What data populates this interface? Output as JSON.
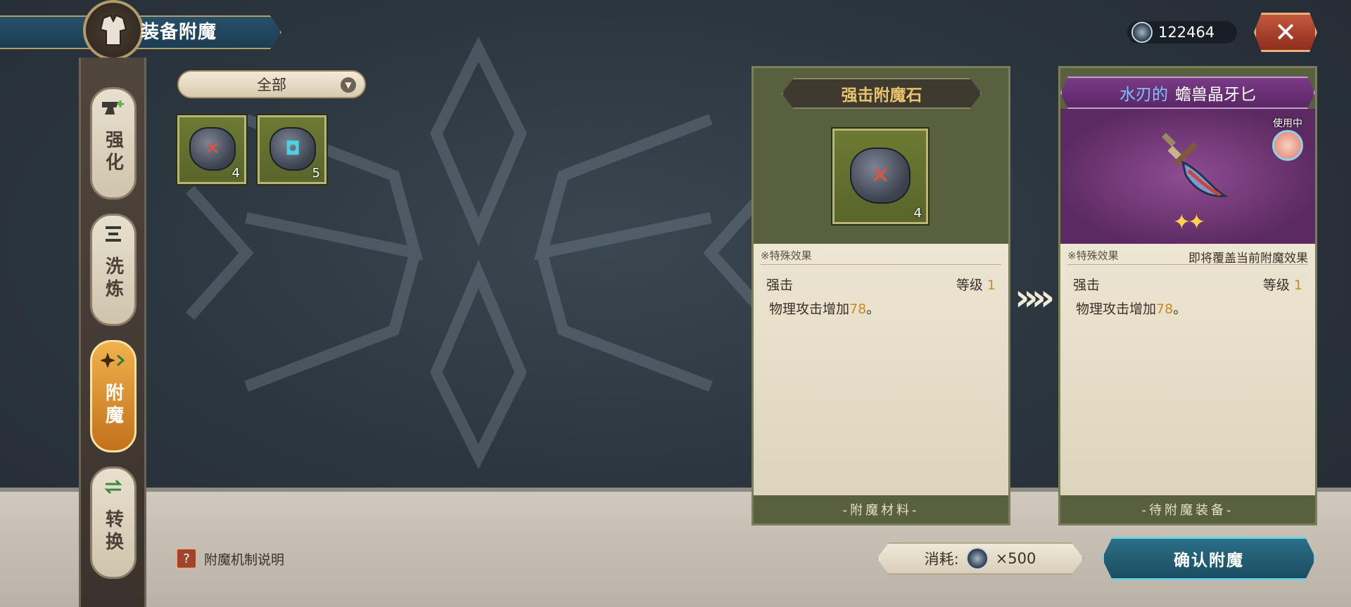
{
  "header": {
    "title": "装备附魔",
    "currency_amount": "122464",
    "close_symbol": "✕"
  },
  "sidebar": {
    "tabs": [
      {
        "label": "强化",
        "icon": "anvil-plus-icon",
        "active": false
      },
      {
        "label": "洗炼",
        "icon": "refine-lines-icon",
        "active": false
      },
      {
        "label": "附魔",
        "icon": "sparkle-arrow-icon",
        "active": true
      },
      {
        "label": "转换",
        "icon": "swap-arrows-icon",
        "active": false
      }
    ]
  },
  "filter": {
    "selected": "全部"
  },
  "inventory": [
    {
      "name": "red rune stone",
      "rune": "✕",
      "rune_color": "#e2503e",
      "count": "4"
    },
    {
      "name": "blue rune stone",
      "rune": "◘",
      "rune_color": "#4ad2e0",
      "count": "5"
    }
  ],
  "material_panel": {
    "name": "强击附魔石",
    "count": "4",
    "section_label": "※特殊效果",
    "effect_name": "强击",
    "level_label": "等级",
    "level_value": "1",
    "desc_prefix": "物理攻击增加",
    "desc_value": "78",
    "desc_suffix": "。",
    "footer": "-附魔材料-"
  },
  "equipment_panel": {
    "name_prefix": "水刃的",
    "name": "蟾兽晶牙匕",
    "in_use_badge": "使用中",
    "stars": "✦✦",
    "section_label": "※特殊效果",
    "overwrite_note": "即将覆盖当前附魔效果",
    "effect_name": "强击",
    "level_label": "等级",
    "level_value": "1",
    "desc_prefix": "物理攻击增加",
    "desc_value": "78",
    "desc_suffix": "。",
    "footer": "-待附魔装备-"
  },
  "transfer_arrows": "»",
  "bottom": {
    "help_label": "附魔机制说明",
    "cost_label": "消耗:",
    "cost_value": "×500",
    "confirm_label": "确认附魔"
  },
  "colors": {
    "accent_gold": "#c78a25",
    "confirm_blue": "#2b6f86",
    "purple_rarity": "#7a3a86"
  }
}
